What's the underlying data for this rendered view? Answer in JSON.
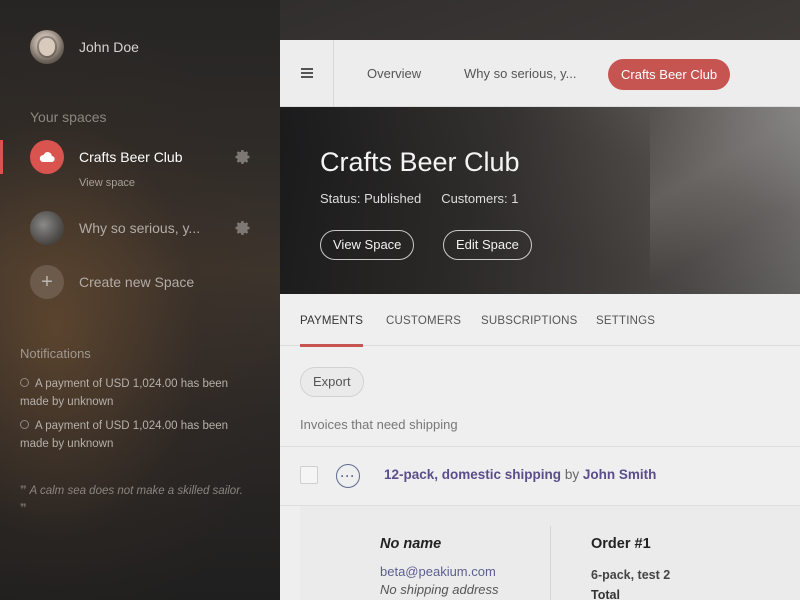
{
  "user": {
    "name": "John Doe"
  },
  "sidebar": {
    "spaces_title": "Your spaces",
    "spaces": [
      {
        "label": "Crafts Beer Club",
        "sub_link": "View space",
        "icon": "cloud-icon"
      },
      {
        "label": "Why so serious, y...",
        "icon": "space-thumbnail"
      },
      {
        "label": "Create new Space",
        "icon": "plus-icon"
      }
    ],
    "notifications_title": "Notifications",
    "notifications": [
      "A payment of USD 1,024.00 has been made by unknown",
      "A payment of USD 1,024.00 has been made by unknown"
    ],
    "quote": "A calm sea does not make a skilled sailor."
  },
  "topbar": {
    "nav": [
      "Overview",
      "Why so serious, y...",
      "Crafts Beer Club"
    ]
  },
  "hero": {
    "title": "Crafts Beer Club",
    "status": "Status: Published",
    "customers": "Customers: 1",
    "view_button": "View Space",
    "edit_button": "Edit Space"
  },
  "tabs": [
    "PAYMENTS",
    "CUSTOMERS",
    "SUBSCRIPTIONS",
    "SETTINGS"
  ],
  "content": {
    "export_button": "Export",
    "section_label": "Invoices that need shipping",
    "invoice": {
      "product": "12-pack, domestic shipping",
      "by": "by",
      "customer": "John Smith"
    },
    "detail": {
      "name": "No name",
      "email": "beta@peakium.com",
      "address": "No shipping address",
      "order": "Order #1",
      "item": "6-pack, test 2",
      "total_label": "Total"
    }
  },
  "colors": {
    "accent": "#c65451",
    "link": "#5b4e8c"
  }
}
